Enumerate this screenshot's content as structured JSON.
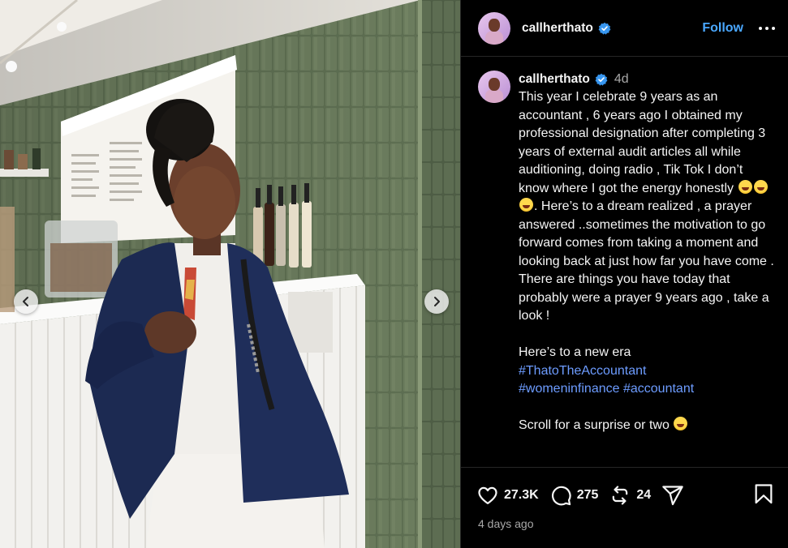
{
  "post": {
    "username": "callherthato",
    "follow_label": "Follow",
    "age": "4d",
    "caption_paragraphs": [
      [
        {
          "t": "This year I celebrate 9 years as an accountant , 6 years ago I obtained my professional designation after completing 3 years of external audit articles all while auditioning, doing radio , Tik Tok I don’t know where I got the energy honestly "
        },
        {
          "emoji": "grinning-squinting-face"
        },
        {
          "emoji": "grinning-squinting-face"
        },
        {
          "emoji": "grinning-squinting-face"
        },
        {
          "t": ". Here’s to a dream realized , a prayer answered ..sometimes the motivation to go forward comes from taking a moment and looking back at just how far you have come . There are things you have today that probably were a prayer 9 years ago , take a look !"
        }
      ],
      [
        {
          "t": "Here’s to a new era"
        },
        {
          "br": true
        },
        {
          "tag": "#ThatoTheAccountant"
        },
        {
          "br": true
        },
        {
          "tag": "#womeninfinance"
        },
        {
          "t": " "
        },
        {
          "tag": "#accountant"
        }
      ],
      [
        {
          "t": "Scroll for a surprise or two "
        },
        {
          "emoji": "grinning-squinting-face"
        }
      ]
    ],
    "likes": "27.3K",
    "comments": "275",
    "reposts": "24",
    "timestamp": "4 days ago"
  },
  "icons": {
    "verified": "verified-badge-icon",
    "like": "heart-icon",
    "comment": "comment-bubble-icon",
    "repost": "repost-icon",
    "share": "share-paper-plane-icon",
    "save": "bookmark-icon",
    "more": "more-options-icon",
    "prev": "chevron-left-icon",
    "next": "chevron-right-icon"
  },
  "colors": {
    "background": "#000000",
    "text": "#f5f5f5",
    "muted": "#a8a8a8",
    "link": "#6d9cff",
    "follow": "#4aa8ff",
    "verified": "#3897f0"
  }
}
